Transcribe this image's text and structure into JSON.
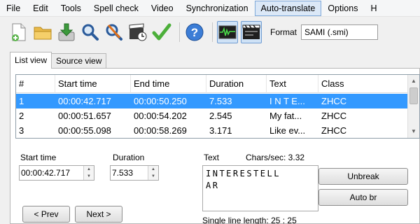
{
  "menu": {
    "items": [
      "File",
      "Edit",
      "Tools",
      "Spell check",
      "Video",
      "Synchronization",
      "Auto-translate",
      "Options",
      "H"
    ],
    "active_index": 6
  },
  "toolbar": {
    "buttons": [
      "new-file-icon",
      "open-folder-icon",
      "save-download-icon",
      "find-icon",
      "replace-icon",
      "visual-sync-icon",
      "spell-check-icon",
      "help-icon",
      "waveform-icon",
      "video-player-icon"
    ],
    "format_label": "Format",
    "format_value": "SAMI (.smi)"
  },
  "tabs": [
    "List view",
    "Source view"
  ],
  "grid": {
    "columns": [
      "#",
      "Start time",
      "End time",
      "Duration",
      "Text",
      "Class"
    ],
    "rows": [
      {
        "num": "1",
        "start": "00:00:42.717",
        "end": "00:00:50.250",
        "duration": "7.533",
        "text": "I N T E...",
        "class": "ZHCC",
        "selected": true
      },
      {
        "num": "2",
        "start": "00:00:51.657",
        "end": "00:00:54.202",
        "duration": "2.545",
        "text": "My fat...",
        "class": "ZHCC",
        "selected": false
      },
      {
        "num": "3",
        "start": "00:00:55.098",
        "end": "00:00:58.269",
        "duration": "3.171",
        "text": "Like ev...",
        "class": "ZHCC",
        "selected": false
      }
    ]
  },
  "editor": {
    "start_time_label": "Start time",
    "start_time_value": "00:00:42.717",
    "duration_label": "Duration",
    "duration_value": "7.533",
    "text_label": "Text",
    "chars_per_sec": "Chars/sec: 3.32",
    "text_value": "INTERESTELL\nAR",
    "unbreak_label": "Unbreak",
    "auto_br_label": "Auto br",
    "prev_label": "< Prev",
    "next_label": "Next >",
    "single_line_length": "Single line length: 25 : 25"
  },
  "colors": {
    "selection": "#3399ff",
    "active_menu": "#dbe8f7"
  }
}
